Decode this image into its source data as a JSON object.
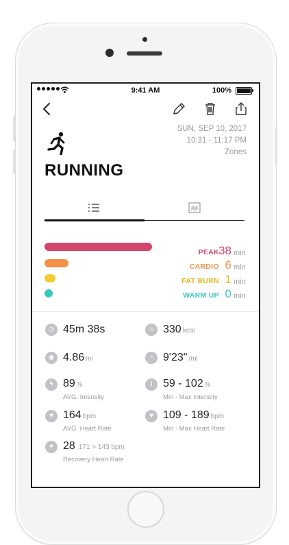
{
  "status_bar": {
    "time": "9:41 AM",
    "battery": "100%"
  },
  "header": {
    "date": "SUN, SEP 10, 2017",
    "time_range": "10:31 - 11:17 PM",
    "zones_link": "Zones"
  },
  "activity": {
    "title": "RUNNING"
  },
  "zones": [
    {
      "label": "PEAK",
      "value": "38",
      "unit": "min",
      "color": "#d2466c"
    },
    {
      "label": "CARDIO",
      "value": "6",
      "unit": "min",
      "color": "#f0914a"
    },
    {
      "label": "FAT BURN",
      "value": "1",
      "unit": "min",
      "color": "#f2cc33"
    },
    {
      "label": "WARM UP",
      "value": "0",
      "unit": "min",
      "color": "#3cc7be"
    }
  ],
  "stats": {
    "duration": {
      "value": "45m 38s"
    },
    "calories": {
      "value": "330",
      "unit": "kcal"
    },
    "distance": {
      "value": "4.86",
      "unit": "mi"
    },
    "pace": {
      "value": "9'23\"",
      "unit": "/mi"
    },
    "avg_intensity": {
      "value": "89",
      "unit": "%",
      "label": "AVG. Intensity"
    },
    "minmax_intensity": {
      "value": "59 - 102",
      "unit": "%",
      "label": "Min - Max Intensity"
    },
    "avg_hr": {
      "value": "164",
      "unit": "bpm",
      "label": "AVG. Heart Rate"
    },
    "minmax_hr": {
      "value": "109 - 189",
      "unit": "bpm",
      "label": "Min - Max Heart Rate"
    },
    "recovery_hr": {
      "value": "28",
      "detail": "171 > 143 bpm",
      "label": "Recovery Heart Rate"
    }
  }
}
